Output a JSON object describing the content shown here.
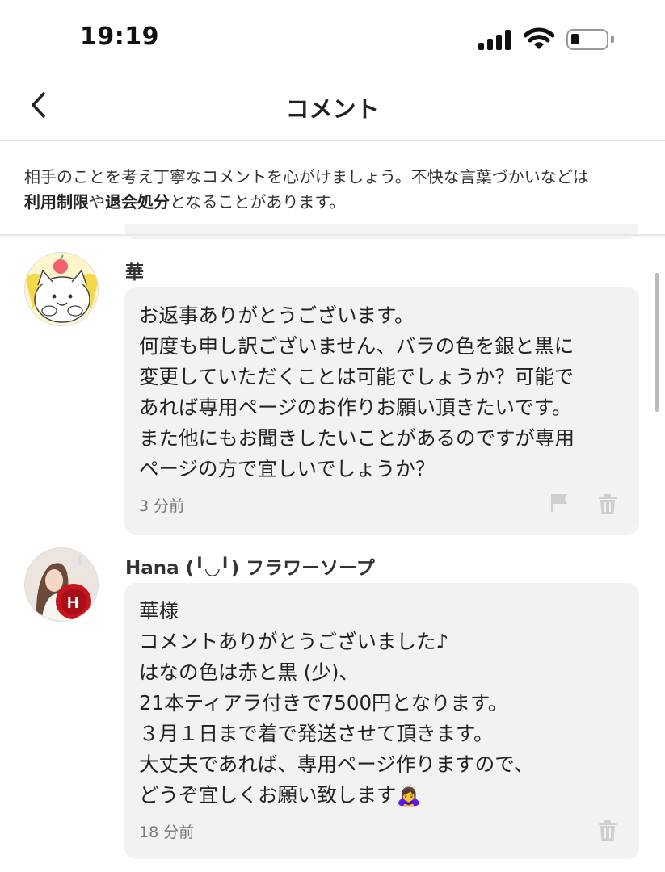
{
  "status_bar": {
    "time": "19:19"
  },
  "header": {
    "title": "コメント"
  },
  "notice": {
    "text_pre": "相手のことを考え丁寧なコメントを心がけましょう。不快な言葉づかいなどは",
    "link1": "利用制限",
    "connector": "や",
    "link2": "退会処分",
    "text_post": "となることがあります。"
  },
  "comments": [
    {
      "author": "華",
      "body": "お返事ありがとうございます。\n何度も申し訳ございません、バラの色を銀と黒に\n変更していただくことは可能でしょうか？可能で\nあれば専用ページのお作りお願い頂きたいです。\nまた他にもお聞きしたいことがあるのですが専用\nページの方で宜しいでしょうか？",
      "time": "3 分前",
      "icons": [
        "flag-icon",
        "trash-icon"
      ]
    },
    {
      "author": "Hana (╹◡╹) フラワーソープ",
      "body": "華様\nコメントありがとうございました♪\nはなの色は赤と黒 (少)、\n21本ティアラ付きで7500円となります。\n３月１日まで着で発送させて頂きます。\n大丈夫であれば、専用ページ作りますので、\nどうぞ宜しくお願い致します🙇‍♀️",
      "time": "18 分前",
      "icons": [
        "trash-icon"
      ]
    }
  ],
  "colors": {
    "bubble": "#f2f2f2",
    "icon_gray": "#cfcfcf",
    "text": "#222222"
  }
}
